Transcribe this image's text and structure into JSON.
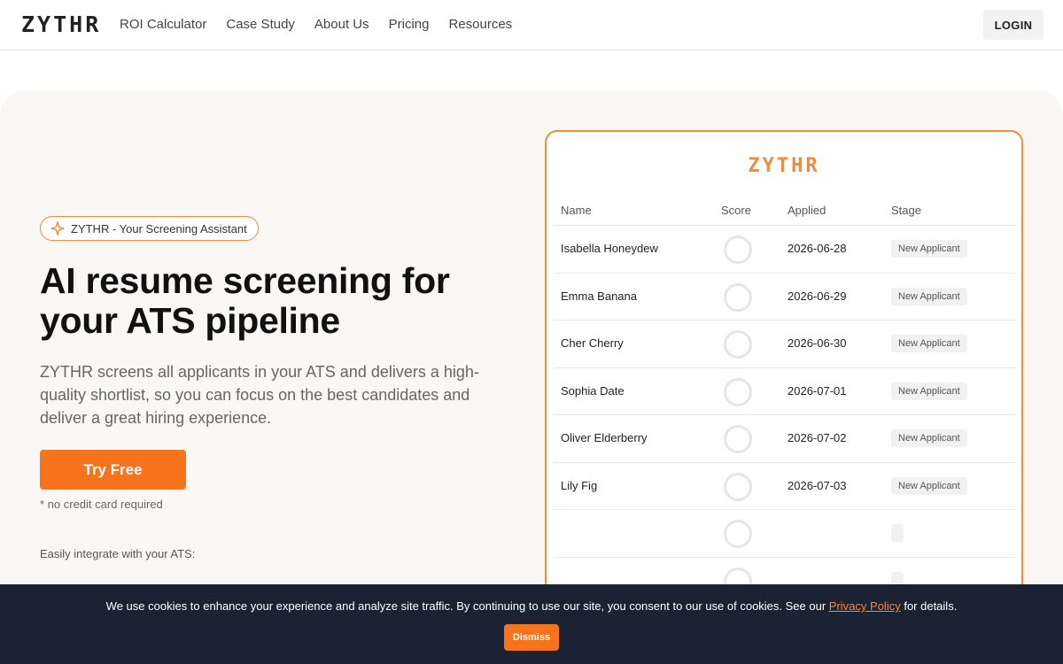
{
  "header": {
    "logo": "ZYTHR",
    "nav": [
      "ROI Calculator",
      "Case Study",
      "About Us",
      "Pricing",
      "Resources"
    ],
    "login": "LOGIN"
  },
  "hero": {
    "badge": "ZYTHR - Your Screening Assistant",
    "title": "AI resume screening for your ATS pipeline",
    "lead": "ZYTHR screens all applicants in your ATS and delivers a high-quality shortlist, so you can focus on the best candidates and deliver a great hiring experience.",
    "cta": "Try Free",
    "note": "* no credit card required",
    "integrate": "Easily integrate with your ATS:"
  },
  "card": {
    "logo": "ZYTHR",
    "columns": [
      "Name",
      "Score",
      "Applied",
      "Stage"
    ],
    "rows": [
      {
        "name": "Isabella Honeydew",
        "date": "2026-06-28",
        "stage": "New Applicant"
      },
      {
        "name": "Emma Banana",
        "date": "2026-06-29",
        "stage": "New Applicant"
      },
      {
        "name": "Cher Cherry",
        "date": "2026-06-30",
        "stage": "New Applicant"
      },
      {
        "name": "Sophia Date",
        "date": "2026-07-01",
        "stage": "New Applicant"
      },
      {
        "name": "Oliver Elderberry",
        "date": "2026-07-02",
        "stage": "New Applicant"
      },
      {
        "name": "Lily Fig",
        "date": "2026-07-03",
        "stage": "New Applicant"
      },
      {
        "name": "",
        "date": "",
        "stage": ""
      },
      {
        "name": "",
        "date": "",
        "stage": ""
      }
    ]
  },
  "cookie": {
    "text_before": "We use cookies to enhance your experience and analyze site traffic. By continuing to use our site, you consent to our use of cookies. See our ",
    "link": "Privacy Policy",
    "text_after": " for details.",
    "dismiss": "Dismiss"
  },
  "colors": {
    "accent": "#f7731c",
    "border_accent": "#f08a3c",
    "cookie_bg": "#1a2233"
  }
}
